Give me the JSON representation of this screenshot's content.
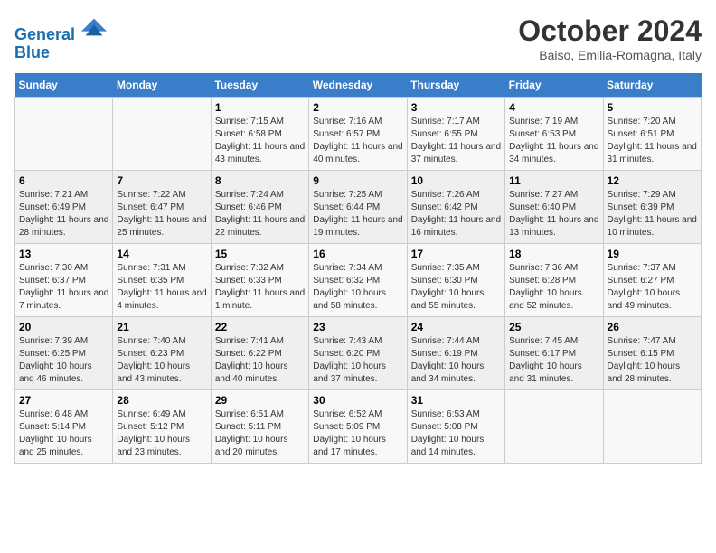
{
  "header": {
    "logo_line1": "General",
    "logo_line2": "Blue",
    "month_title": "October 2024",
    "location": "Baiso, Emilia-Romagna, Italy"
  },
  "days_of_week": [
    "Sunday",
    "Monday",
    "Tuesday",
    "Wednesday",
    "Thursday",
    "Friday",
    "Saturday"
  ],
  "weeks": [
    [
      {
        "day": "",
        "info": ""
      },
      {
        "day": "",
        "info": ""
      },
      {
        "day": "1",
        "info": "Sunrise: 7:15 AM\nSunset: 6:58 PM\nDaylight: 11 hours and 43 minutes."
      },
      {
        "day": "2",
        "info": "Sunrise: 7:16 AM\nSunset: 6:57 PM\nDaylight: 11 hours and 40 minutes."
      },
      {
        "day": "3",
        "info": "Sunrise: 7:17 AM\nSunset: 6:55 PM\nDaylight: 11 hours and 37 minutes."
      },
      {
        "day": "4",
        "info": "Sunrise: 7:19 AM\nSunset: 6:53 PM\nDaylight: 11 hours and 34 minutes."
      },
      {
        "day": "5",
        "info": "Sunrise: 7:20 AM\nSunset: 6:51 PM\nDaylight: 11 hours and 31 minutes."
      }
    ],
    [
      {
        "day": "6",
        "info": "Sunrise: 7:21 AM\nSunset: 6:49 PM\nDaylight: 11 hours and 28 minutes."
      },
      {
        "day": "7",
        "info": "Sunrise: 7:22 AM\nSunset: 6:47 PM\nDaylight: 11 hours and 25 minutes."
      },
      {
        "day": "8",
        "info": "Sunrise: 7:24 AM\nSunset: 6:46 PM\nDaylight: 11 hours and 22 minutes."
      },
      {
        "day": "9",
        "info": "Sunrise: 7:25 AM\nSunset: 6:44 PM\nDaylight: 11 hours and 19 minutes."
      },
      {
        "day": "10",
        "info": "Sunrise: 7:26 AM\nSunset: 6:42 PM\nDaylight: 11 hours and 16 minutes."
      },
      {
        "day": "11",
        "info": "Sunrise: 7:27 AM\nSunset: 6:40 PM\nDaylight: 11 hours and 13 minutes."
      },
      {
        "day": "12",
        "info": "Sunrise: 7:29 AM\nSunset: 6:39 PM\nDaylight: 11 hours and 10 minutes."
      }
    ],
    [
      {
        "day": "13",
        "info": "Sunrise: 7:30 AM\nSunset: 6:37 PM\nDaylight: 11 hours and 7 minutes."
      },
      {
        "day": "14",
        "info": "Sunrise: 7:31 AM\nSunset: 6:35 PM\nDaylight: 11 hours and 4 minutes."
      },
      {
        "day": "15",
        "info": "Sunrise: 7:32 AM\nSunset: 6:33 PM\nDaylight: 11 hours and 1 minute."
      },
      {
        "day": "16",
        "info": "Sunrise: 7:34 AM\nSunset: 6:32 PM\nDaylight: 10 hours and 58 minutes."
      },
      {
        "day": "17",
        "info": "Sunrise: 7:35 AM\nSunset: 6:30 PM\nDaylight: 10 hours and 55 minutes."
      },
      {
        "day": "18",
        "info": "Sunrise: 7:36 AM\nSunset: 6:28 PM\nDaylight: 10 hours and 52 minutes."
      },
      {
        "day": "19",
        "info": "Sunrise: 7:37 AM\nSunset: 6:27 PM\nDaylight: 10 hours and 49 minutes."
      }
    ],
    [
      {
        "day": "20",
        "info": "Sunrise: 7:39 AM\nSunset: 6:25 PM\nDaylight: 10 hours and 46 minutes."
      },
      {
        "day": "21",
        "info": "Sunrise: 7:40 AM\nSunset: 6:23 PM\nDaylight: 10 hours and 43 minutes."
      },
      {
        "day": "22",
        "info": "Sunrise: 7:41 AM\nSunset: 6:22 PM\nDaylight: 10 hours and 40 minutes."
      },
      {
        "day": "23",
        "info": "Sunrise: 7:43 AM\nSunset: 6:20 PM\nDaylight: 10 hours and 37 minutes."
      },
      {
        "day": "24",
        "info": "Sunrise: 7:44 AM\nSunset: 6:19 PM\nDaylight: 10 hours and 34 minutes."
      },
      {
        "day": "25",
        "info": "Sunrise: 7:45 AM\nSunset: 6:17 PM\nDaylight: 10 hours and 31 minutes."
      },
      {
        "day": "26",
        "info": "Sunrise: 7:47 AM\nSunset: 6:15 PM\nDaylight: 10 hours and 28 minutes."
      }
    ],
    [
      {
        "day": "27",
        "info": "Sunrise: 6:48 AM\nSunset: 5:14 PM\nDaylight: 10 hours and 25 minutes."
      },
      {
        "day": "28",
        "info": "Sunrise: 6:49 AM\nSunset: 5:12 PM\nDaylight: 10 hours and 23 minutes."
      },
      {
        "day": "29",
        "info": "Sunrise: 6:51 AM\nSunset: 5:11 PM\nDaylight: 10 hours and 20 minutes."
      },
      {
        "day": "30",
        "info": "Sunrise: 6:52 AM\nSunset: 5:09 PM\nDaylight: 10 hours and 17 minutes."
      },
      {
        "day": "31",
        "info": "Sunrise: 6:53 AM\nSunset: 5:08 PM\nDaylight: 10 hours and 14 minutes."
      },
      {
        "day": "",
        "info": ""
      },
      {
        "day": "",
        "info": ""
      }
    ]
  ]
}
